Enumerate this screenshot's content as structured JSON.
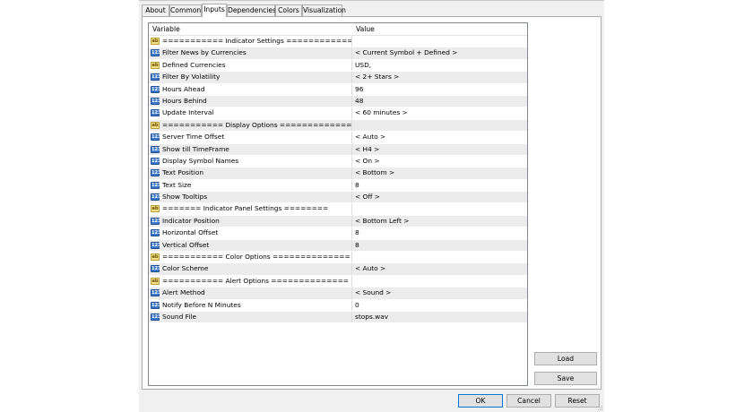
{
  "tabs": [
    {
      "label": "About"
    },
    {
      "label": "Common"
    },
    {
      "label": "Inputs"
    },
    {
      "label": "Dependencies"
    },
    {
      "label": "Colors"
    },
    {
      "label": "Visualization"
    }
  ],
  "active_tab": "Inputs",
  "grid": {
    "headers": {
      "variable": "Variable",
      "value": "Value"
    },
    "rows": [
      {
        "type": "ab",
        "icon_text": "ab",
        "variable": "=========== Indicator Settings ==============",
        "value": ""
      },
      {
        "type": "num",
        "icon_text": "123",
        "variable": "Filter News by Currencies",
        "value": "< Current Symbol + Defined >"
      },
      {
        "type": "ab",
        "icon_text": "ab",
        "variable": "Defined Currencies",
        "value": "USD,"
      },
      {
        "type": "num",
        "icon_text": "123",
        "variable": "Filter By Volatility",
        "value": "< 2+ Stars >"
      },
      {
        "type": "num",
        "icon_text": "123",
        "variable": "Hours Ahead",
        "value": "96"
      },
      {
        "type": "num",
        "icon_text": "123",
        "variable": "Hours Behind",
        "value": "48"
      },
      {
        "type": "num",
        "icon_text": "123",
        "variable": "Update Interval",
        "value": "< 60 minutes >"
      },
      {
        "type": "ab",
        "icon_text": "ab",
        "variable": "=========== Display Options ==============",
        "value": ""
      },
      {
        "type": "num",
        "icon_text": "123",
        "variable": "Server Time Offset",
        "value": "< Auto >"
      },
      {
        "type": "num",
        "icon_text": "123",
        "variable": "Show till TimeFrame",
        "value": "< H4 >"
      },
      {
        "type": "num",
        "icon_text": "123",
        "variable": "Display Symbol Names",
        "value": "< On >"
      },
      {
        "type": "num",
        "icon_text": "123",
        "variable": "Text Position",
        "value": "< Bottom >"
      },
      {
        "type": "num",
        "icon_text": "123",
        "variable": "Text Size",
        "value": "8"
      },
      {
        "type": "num",
        "icon_text": "123",
        "variable": "Show Tooltips",
        "value": "< Off >"
      },
      {
        "type": "ab",
        "icon_text": "ab",
        "variable": "======= Indicator Panel Settings ========",
        "value": ""
      },
      {
        "type": "num",
        "icon_text": "123",
        "variable": "Indicator Position",
        "value": "< Bottom Left >"
      },
      {
        "type": "num",
        "icon_text": "123",
        "variable": "Horizontal Offset",
        "value": "8"
      },
      {
        "type": "num",
        "icon_text": "123",
        "variable": "Vertical Offset",
        "value": "8"
      },
      {
        "type": "ab",
        "icon_text": "ab",
        "variable": "=========== Color Options ==============",
        "value": ""
      },
      {
        "type": "num",
        "icon_text": "123",
        "variable": "Color Scheme",
        "value": "< Auto >"
      },
      {
        "type": "ab",
        "icon_text": "ab",
        "variable": "=========== Alert Options ==============",
        "value": ""
      },
      {
        "type": "num",
        "icon_text": "123",
        "variable": "Alert Method",
        "value": "< Sound >"
      },
      {
        "type": "num",
        "icon_text": "123",
        "variable": "Notify Before N Minutes",
        "value": "0"
      },
      {
        "type": "ab",
        "icon_text": "123",
        "variable": "Sound File",
        "value": "stops.wav"
      }
    ]
  },
  "side_buttons": {
    "load": "Load",
    "save": "Save"
  },
  "footer_buttons": {
    "ok": "OK",
    "cancel": "Cancel",
    "reset": "Reset"
  },
  "colors": {
    "accent": "#0078d7",
    "row_alt": "#ececec",
    "icon_num": "#3d78c8",
    "icon_str": "#f2e08a"
  }
}
